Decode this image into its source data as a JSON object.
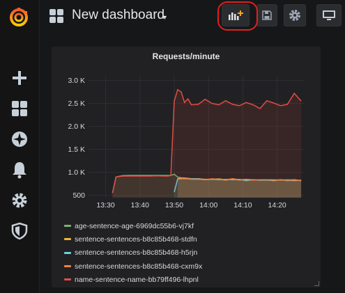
{
  "header": {
    "dashboard_title": "New dashboard",
    "caret": "▾"
  },
  "toolbar": {
    "icons": [
      "add-panel-icon",
      "save-icon",
      "settings-icon",
      "tv-icon"
    ],
    "highlight_color": "#e0201e"
  },
  "sidebar": {
    "icons": [
      "grafana-logo",
      "plus-icon",
      "dashboards-icon",
      "explore-icon",
      "alerting-icon",
      "configuration-icon",
      "shield-icon"
    ]
  },
  "panel": {
    "title": "Requests/minute"
  },
  "chart_data": {
    "type": "line",
    "title": "Requests/minute",
    "xlabel": "",
    "ylabel": "",
    "x_ticks": [
      "13:30",
      "13:40",
      "13:50",
      "14:00",
      "14:10",
      "14:20"
    ],
    "y_ticks": [
      "500",
      "1.0 K",
      "1.5 K",
      "2.0 K",
      "2.5 K",
      "3.0 K"
    ],
    "y_tick_values": [
      500,
      1000,
      1500,
      2000,
      2500,
      3000
    ],
    "ylim": [
      450,
      3100
    ],
    "xlim": [
      "13:25",
      "14:28"
    ],
    "grid": true,
    "legend_position": "bottom",
    "x": [
      "13:32",
      "13:33",
      "13:35",
      "13:37",
      "13:40",
      "13:43",
      "13:45",
      "13:47",
      "13:48",
      "13:49",
      "13:50",
      "13:51",
      "13:52",
      "13:53",
      "13:54",
      "13:55",
      "13:57",
      "13:59",
      "14:01",
      "14:03",
      "14:05",
      "14:07",
      "14:09",
      "14:11",
      "14:13",
      "14:15",
      "14:17",
      "14:19",
      "14:21",
      "14:23",
      "14:25",
      "14:27"
    ],
    "series": [
      {
        "name": "age-sentence-age-6969dc55b6-vj7kf",
        "color": "#7eb26d",
        "values": [
          550,
          900,
          930,
          935,
          935,
          935,
          935,
          935,
          935,
          935,
          960,
          900,
          880,
          880,
          870,
          860,
          860,
          840,
          850,
          860,
          840,
          850,
          830,
          850,
          840,
          830,
          840,
          830,
          840,
          820,
          840,
          820
        ]
      },
      {
        "name": "sentence-sentences-b8c85b468-stdfn",
        "color": "#eab839",
        "values": [
          null,
          null,
          null,
          null,
          null,
          null,
          null,
          null,
          null,
          null,
          null,
          860,
          880,
          870,
          870,
          860,
          860,
          850,
          850,
          850,
          830,
          860,
          840,
          840,
          840,
          830,
          840,
          820,
          840,
          830,
          840,
          820
        ]
      },
      {
        "name": "sentence-sentences-b8c85b468-h5rjn",
        "color": "#6ed0e0",
        "values": [
          null,
          null,
          null,
          null,
          null,
          null,
          null,
          null,
          null,
          null,
          570,
          860,
          870,
          860,
          860,
          860,
          860,
          840,
          850,
          840,
          850,
          840,
          850,
          820,
          840,
          830,
          830,
          830,
          830,
          830,
          820,
          830
        ]
      },
      {
        "name": "sentence-sentences-b8c85b468-cxm9x",
        "color": "#ef843c",
        "values": [
          null,
          null,
          null,
          null,
          null,
          null,
          null,
          null,
          null,
          null,
          null,
          850,
          860,
          860,
          860,
          850,
          850,
          840,
          860,
          850,
          840,
          860,
          840,
          850,
          830,
          840,
          840,
          840,
          830,
          840,
          830,
          820
        ]
      },
      {
        "name": "name-sentence-name-bb79ff496-lhpnl",
        "color": "#e24d42",
        "values": [
          550,
          900,
          920,
          920,
          920,
          920,
          925,
          920,
          920,
          930,
          2550,
          2800,
          2750,
          2520,
          2600,
          2470,
          2480,
          2590,
          2500,
          2470,
          2560,
          2480,
          2450,
          2520,
          2470,
          2390,
          2560,
          2510,
          2450,
          2480,
          2720,
          2550
        ]
      }
    ]
  }
}
